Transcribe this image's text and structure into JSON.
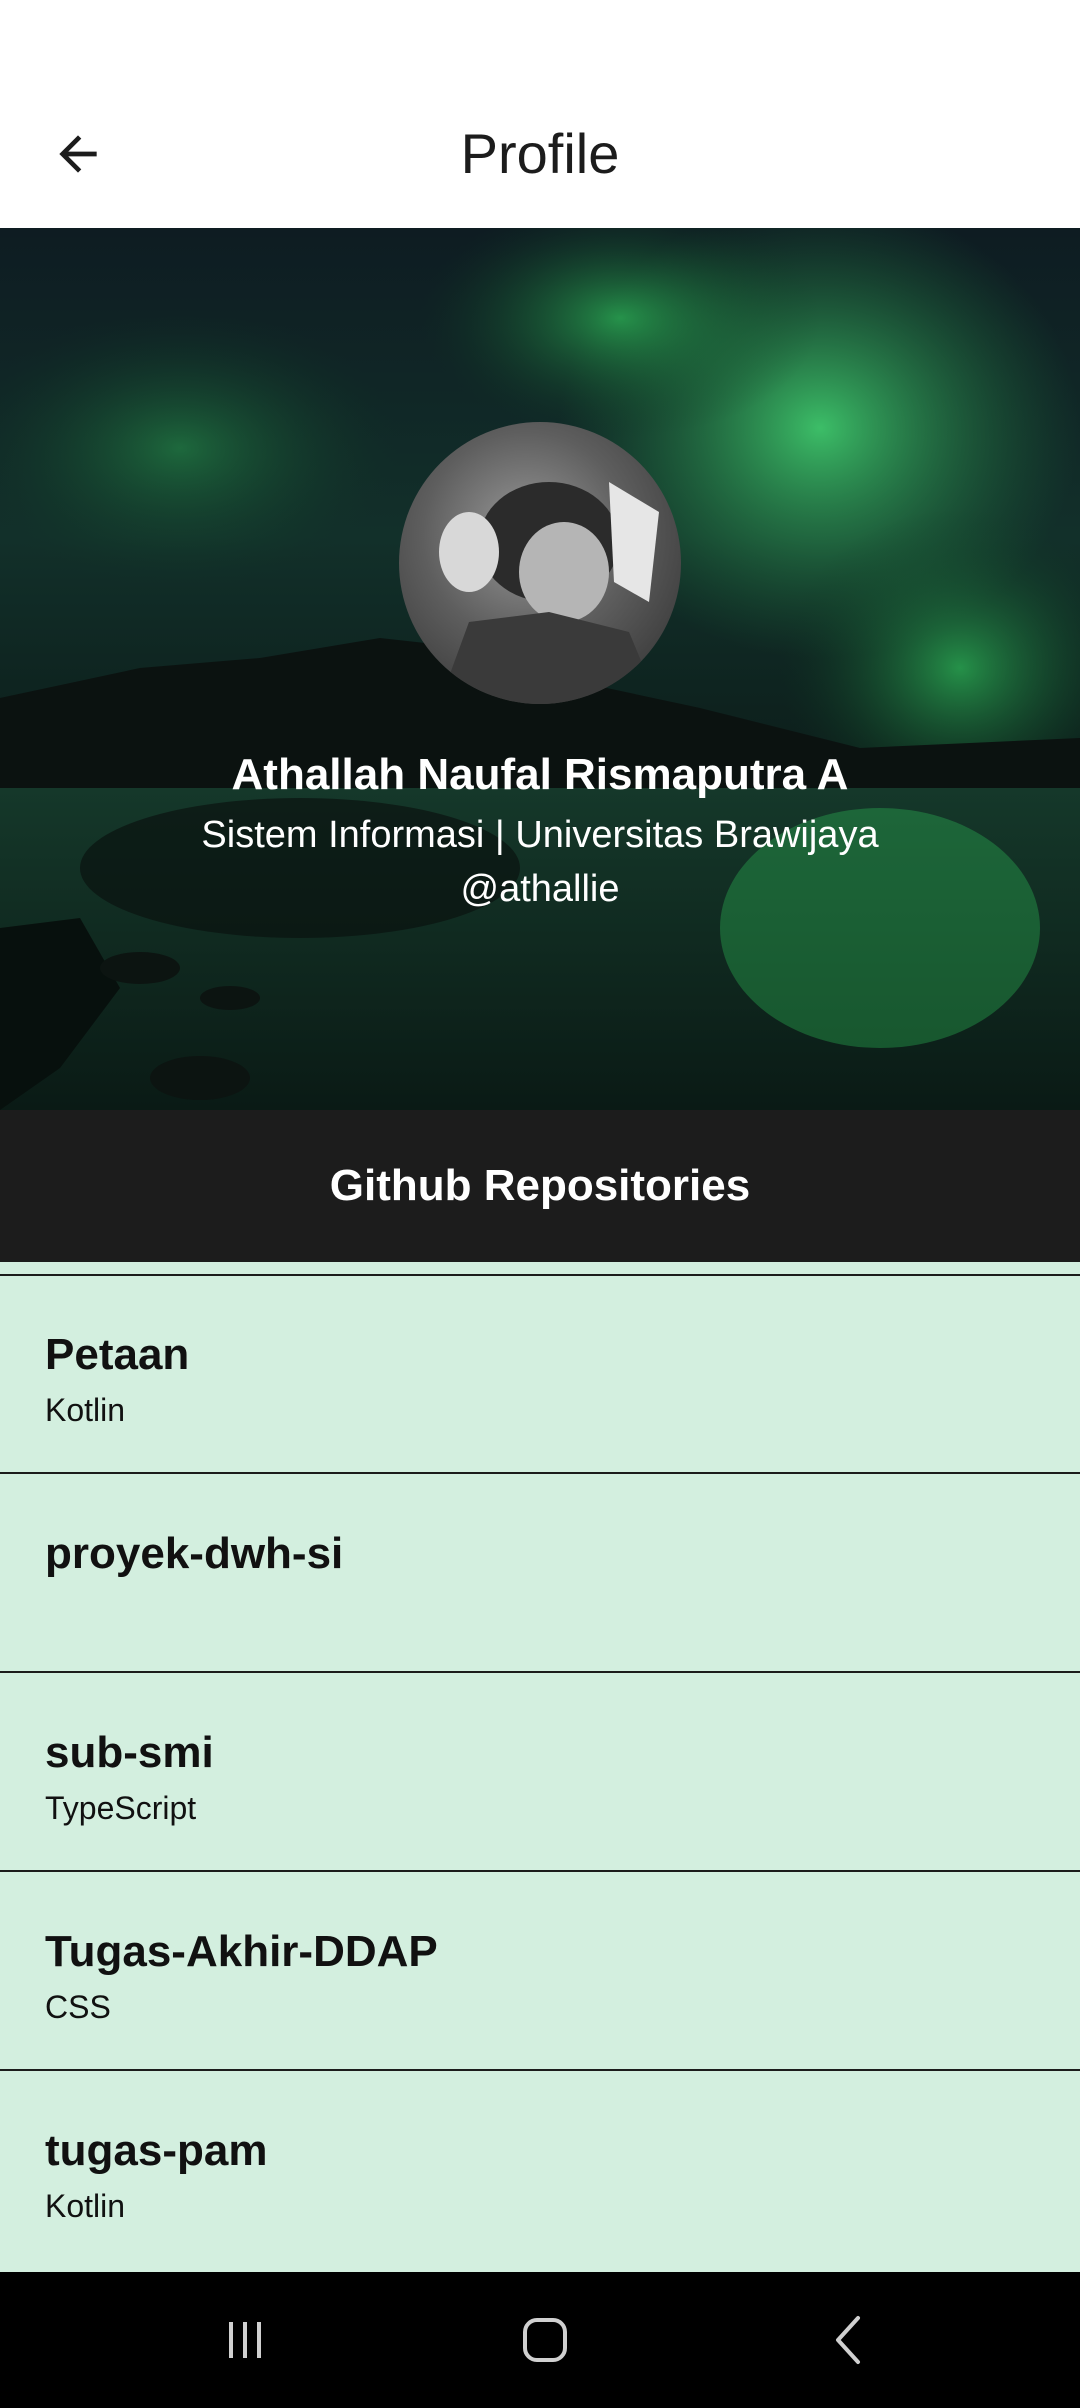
{
  "app_bar": {
    "title": "Profile",
    "back_icon": "arrow-left-icon"
  },
  "profile": {
    "name": "Athallah Naufal Rismaputra A",
    "subtitle": "Sistem Informasi | Universitas Brawijaya",
    "username": "@athallie"
  },
  "repositories": {
    "header": "Github Repositories",
    "items": [
      {
        "name": "Petaan",
        "language": "Kotlin"
      },
      {
        "name": "proyek-dwh-si",
        "language": ""
      },
      {
        "name": "sub-smi",
        "language": "TypeScript"
      },
      {
        "name": "Tugas-Akhir-DDAP",
        "language": "CSS"
      },
      {
        "name": "tugas-pam",
        "language": "Kotlin"
      }
    ]
  },
  "nav_bar": {
    "recents_icon": "recents-icon",
    "home_icon": "home-icon",
    "back_icon": "back-chevron-icon"
  },
  "colors": {
    "list_background": "#d3efdf",
    "section_header": "#1c1c1c",
    "aurora_green": "#2fbf5a"
  }
}
